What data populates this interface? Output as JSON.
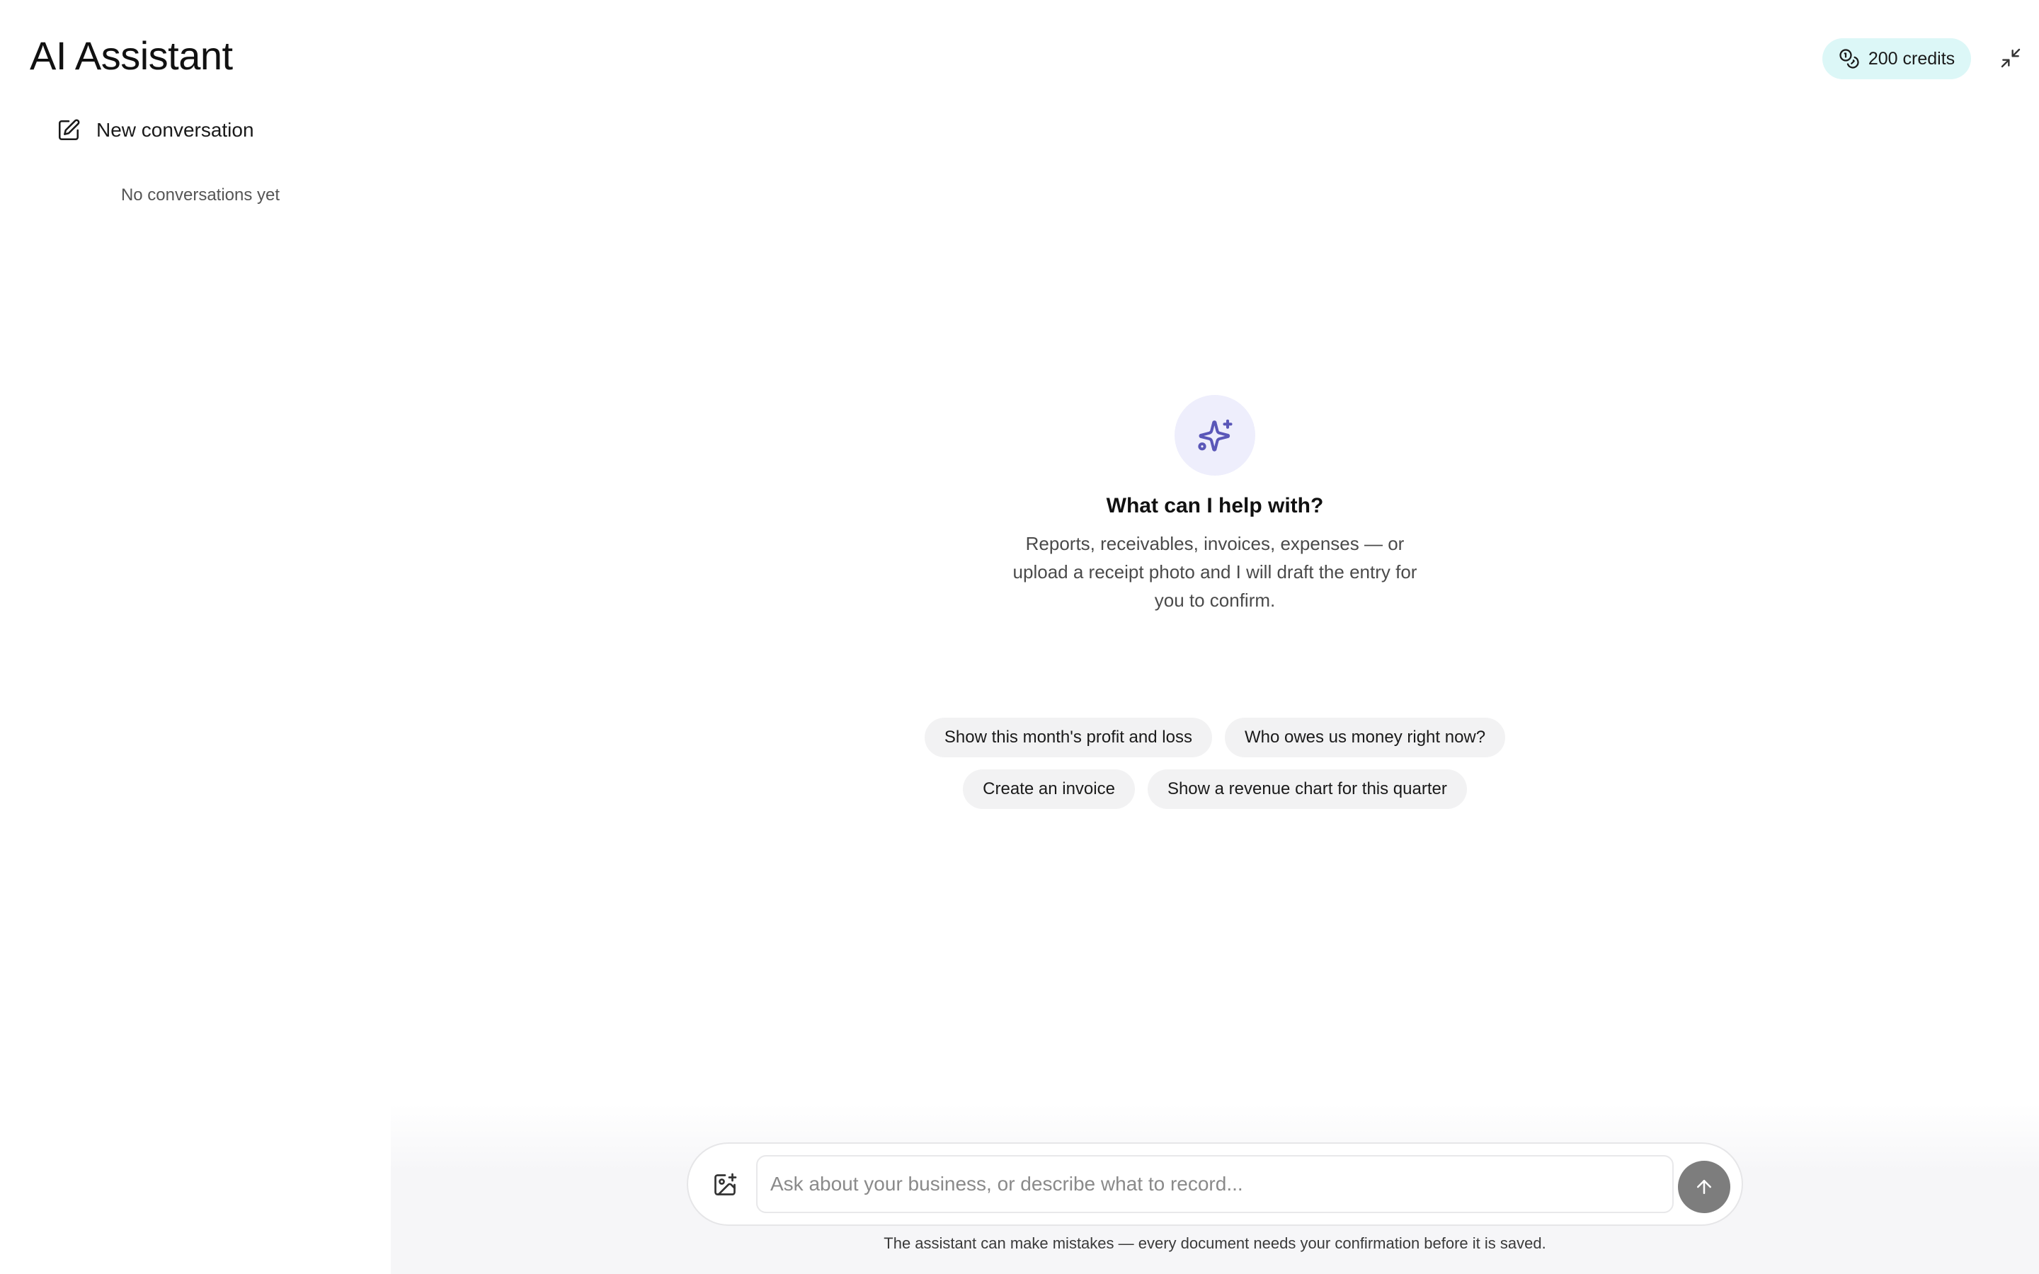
{
  "header": {
    "title": "AI Assistant",
    "credits": "200 credits",
    "credits_icon": "coins-icon",
    "collapse_icon": "minimize-icon"
  },
  "sidebar": {
    "new_conversation_label": "New conversation",
    "new_conversation_icon": "edit-icon",
    "empty_state": "No conversations yet"
  },
  "main": {
    "hero_icon": "sparkles-icon",
    "hero_title": "What can I help with?",
    "hero_subtitle": "Reports, receivables, invoices, expenses — or upload a receipt photo and I will draft the entry for you to confirm.",
    "suggestions": [
      "Show this month's profit and loss",
      "Who owes us money right now?",
      "Create an invoice",
      "Show a revenue chart for this quarter"
    ]
  },
  "composer": {
    "placeholder": "Ask about your business, or describe what to record...",
    "value": "",
    "upload_icon": "image-plus-icon",
    "send_icon": "arrow-up-icon",
    "disclaimer": "The assistant can make mistakes — every document needs your confirmation before it is saved."
  },
  "colors": {
    "credits_bg": "#dcf7f7",
    "hero_icon_bg": "#eeeefc",
    "hero_icon_fg": "#5a57b8",
    "chip_bg": "#f2f2f3",
    "send_bg": "#7d7d7d"
  }
}
